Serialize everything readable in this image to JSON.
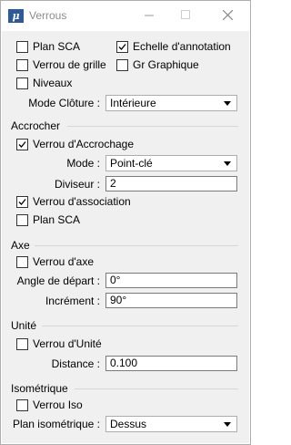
{
  "window": {
    "title": "Verrous",
    "icon_letter": "μ"
  },
  "general": {
    "plan_sca": "Plan SCA",
    "echelle_annotation": "Echelle d'annotation",
    "verrou_grille": "Verrou de grille",
    "gr_graphique": "Gr Graphique",
    "niveaux": "Niveaux",
    "mode_cloture_label": "Mode Clôture :",
    "mode_cloture_value": "Intérieure"
  },
  "accrocher": {
    "heading": "Accrocher",
    "verrou_accrochage": "Verrou d'Accrochage",
    "mode_label": "Mode :",
    "mode_value": "Point-clé",
    "diviseur_label": "Diviseur :",
    "diviseur_value": "2",
    "verrou_association": "Verrou d'association",
    "plan_sca": "Plan SCA"
  },
  "axe": {
    "heading": "Axe",
    "verrou_axe": "Verrou d'axe",
    "angle_label": "Angle de départ :",
    "angle_value": "0°",
    "increment_label": "Incrément :",
    "increment_value": "90°"
  },
  "unite": {
    "heading": "Unité",
    "verrou_unite": "Verrou d'Unité",
    "distance_label": "Distance :",
    "distance_value": "0.100"
  },
  "isometrique": {
    "heading": "Isométrique",
    "verrou_iso": "Verrou Iso",
    "plan_label": "Plan isométrique :",
    "plan_value": "Dessus"
  },
  "checked": {
    "plan_sca": false,
    "echelle_annotation": true,
    "verrou_grille": false,
    "gr_graphique": false,
    "niveaux": false,
    "verrou_accrochage": true,
    "verrou_association": true,
    "plan_sca_2": false,
    "verrou_axe": false,
    "verrou_unite": false,
    "verrou_iso": false
  }
}
